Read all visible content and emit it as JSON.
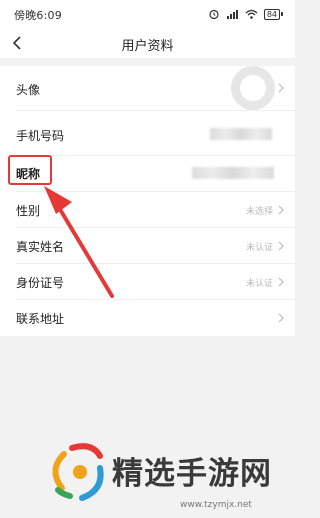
{
  "status_bar": {
    "time": "傍晚6:09",
    "battery": "84"
  },
  "nav": {
    "title": "用户资料"
  },
  "rows": [
    {
      "label": "头像",
      "value": ""
    },
    {
      "label": "手机号码",
      "value": ""
    },
    {
      "label": "昵称",
      "value": ""
    },
    {
      "label": "性别",
      "value": "未选择"
    },
    {
      "label": "真实姓名",
      "value": "未认证"
    },
    {
      "label": "身份证号",
      "value": "未认证"
    },
    {
      "label": "联系地址",
      "value": ""
    }
  ],
  "watermark": {
    "brand": "精选手游网",
    "url": "www.tzymjx.net"
  },
  "colors": {
    "highlight": "#e53935",
    "arrow": "#e53935",
    "value_gray": "#b9b9b9",
    "background": "#f2f2f2"
  },
  "icons": [
    "back-icon",
    "chevron-right-icon",
    "wifi-icon",
    "signal-icon",
    "battery-icon",
    "alarm-icon",
    "avatar-placeholder-icon",
    "logo-icon"
  ]
}
